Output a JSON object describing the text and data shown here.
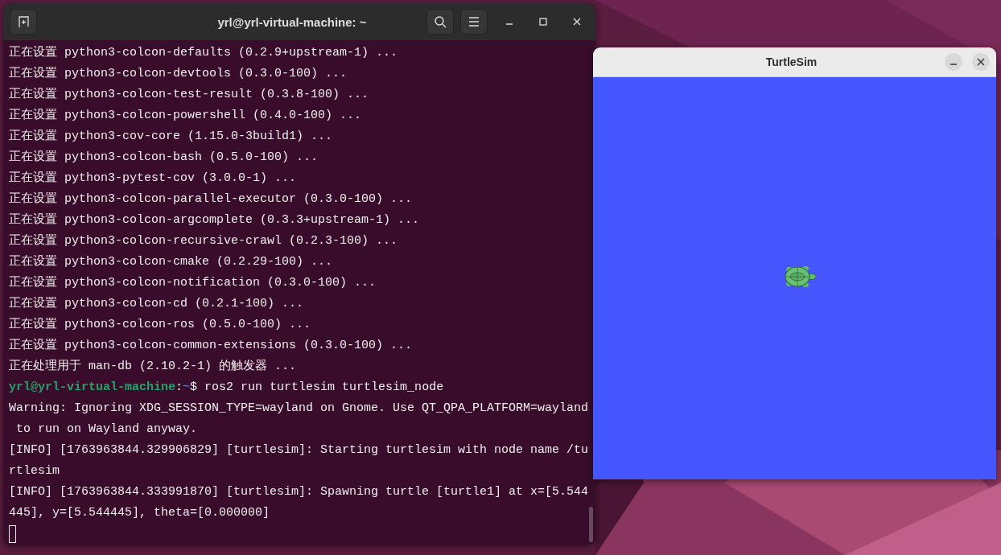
{
  "terminal": {
    "title": "yrl@yrl-virtual-machine: ~",
    "lines": [
      {
        "kind": "output",
        "text": "正在设置 python3-colcon-defaults (0.2.9+upstream-1) ..."
      },
      {
        "kind": "output",
        "text": "正在设置 python3-colcon-devtools (0.3.0-100) ..."
      },
      {
        "kind": "output",
        "text": "正在设置 python3-colcon-test-result (0.3.8-100) ..."
      },
      {
        "kind": "output",
        "text": "正在设置 python3-colcon-powershell (0.4.0-100) ..."
      },
      {
        "kind": "output",
        "text": "正在设置 python3-cov-core (1.15.0-3build1) ..."
      },
      {
        "kind": "output",
        "text": "正在设置 python3-colcon-bash (0.5.0-100) ..."
      },
      {
        "kind": "output",
        "text": "正在设置 python3-pytest-cov (3.0.0-1) ..."
      },
      {
        "kind": "output",
        "text": "正在设置 python3-colcon-parallel-executor (0.3.0-100) ..."
      },
      {
        "kind": "output",
        "text": "正在设置 python3-colcon-argcomplete (0.3.3+upstream-1) ..."
      },
      {
        "kind": "output",
        "text": "正在设置 python3-colcon-recursive-crawl (0.2.3-100) ..."
      },
      {
        "kind": "output",
        "text": "正在设置 python3-colcon-cmake (0.2.29-100) ..."
      },
      {
        "kind": "output",
        "text": "正在设置 python3-colcon-notification (0.3.0-100) ..."
      },
      {
        "kind": "output",
        "text": "正在设置 python3-colcon-cd (0.2.1-100) ..."
      },
      {
        "kind": "output",
        "text": "正在设置 python3-colcon-ros (0.5.0-100) ..."
      },
      {
        "kind": "output",
        "text": "正在设置 python3-colcon-common-extensions (0.3.0-100) ..."
      },
      {
        "kind": "output",
        "text": "正在处理用于 man-db (2.10.2-1) 的触发器 ..."
      },
      {
        "kind": "prompt",
        "user": "yrl@yrl-virtual-machine",
        "separator": ":",
        "path": "~",
        "command": "$ ros2 run turtlesim turtlesim_node"
      },
      {
        "kind": "output",
        "text": "Warning: Ignoring XDG_SESSION_TYPE=wayland on Gnome. Use QT_QPA_PLATFORM=wayland"
      },
      {
        "kind": "output",
        "text": " to run on Wayland anyway."
      },
      {
        "kind": "output",
        "text": "[INFO] [1763963844.329906829] [turtlesim]: Starting turtlesim with node name /tu"
      },
      {
        "kind": "output",
        "text": "rtlesim"
      },
      {
        "kind": "output",
        "text": "[INFO] [1763963844.333991870] [turtlesim]: Spawning turtle [turtle1] at x=[5.544"
      },
      {
        "kind": "output",
        "text": "445], y=[5.544445], theta=[0.000000]"
      },
      {
        "kind": "cursor"
      }
    ]
  },
  "turtlesim": {
    "title": "TurtleSim"
  }
}
